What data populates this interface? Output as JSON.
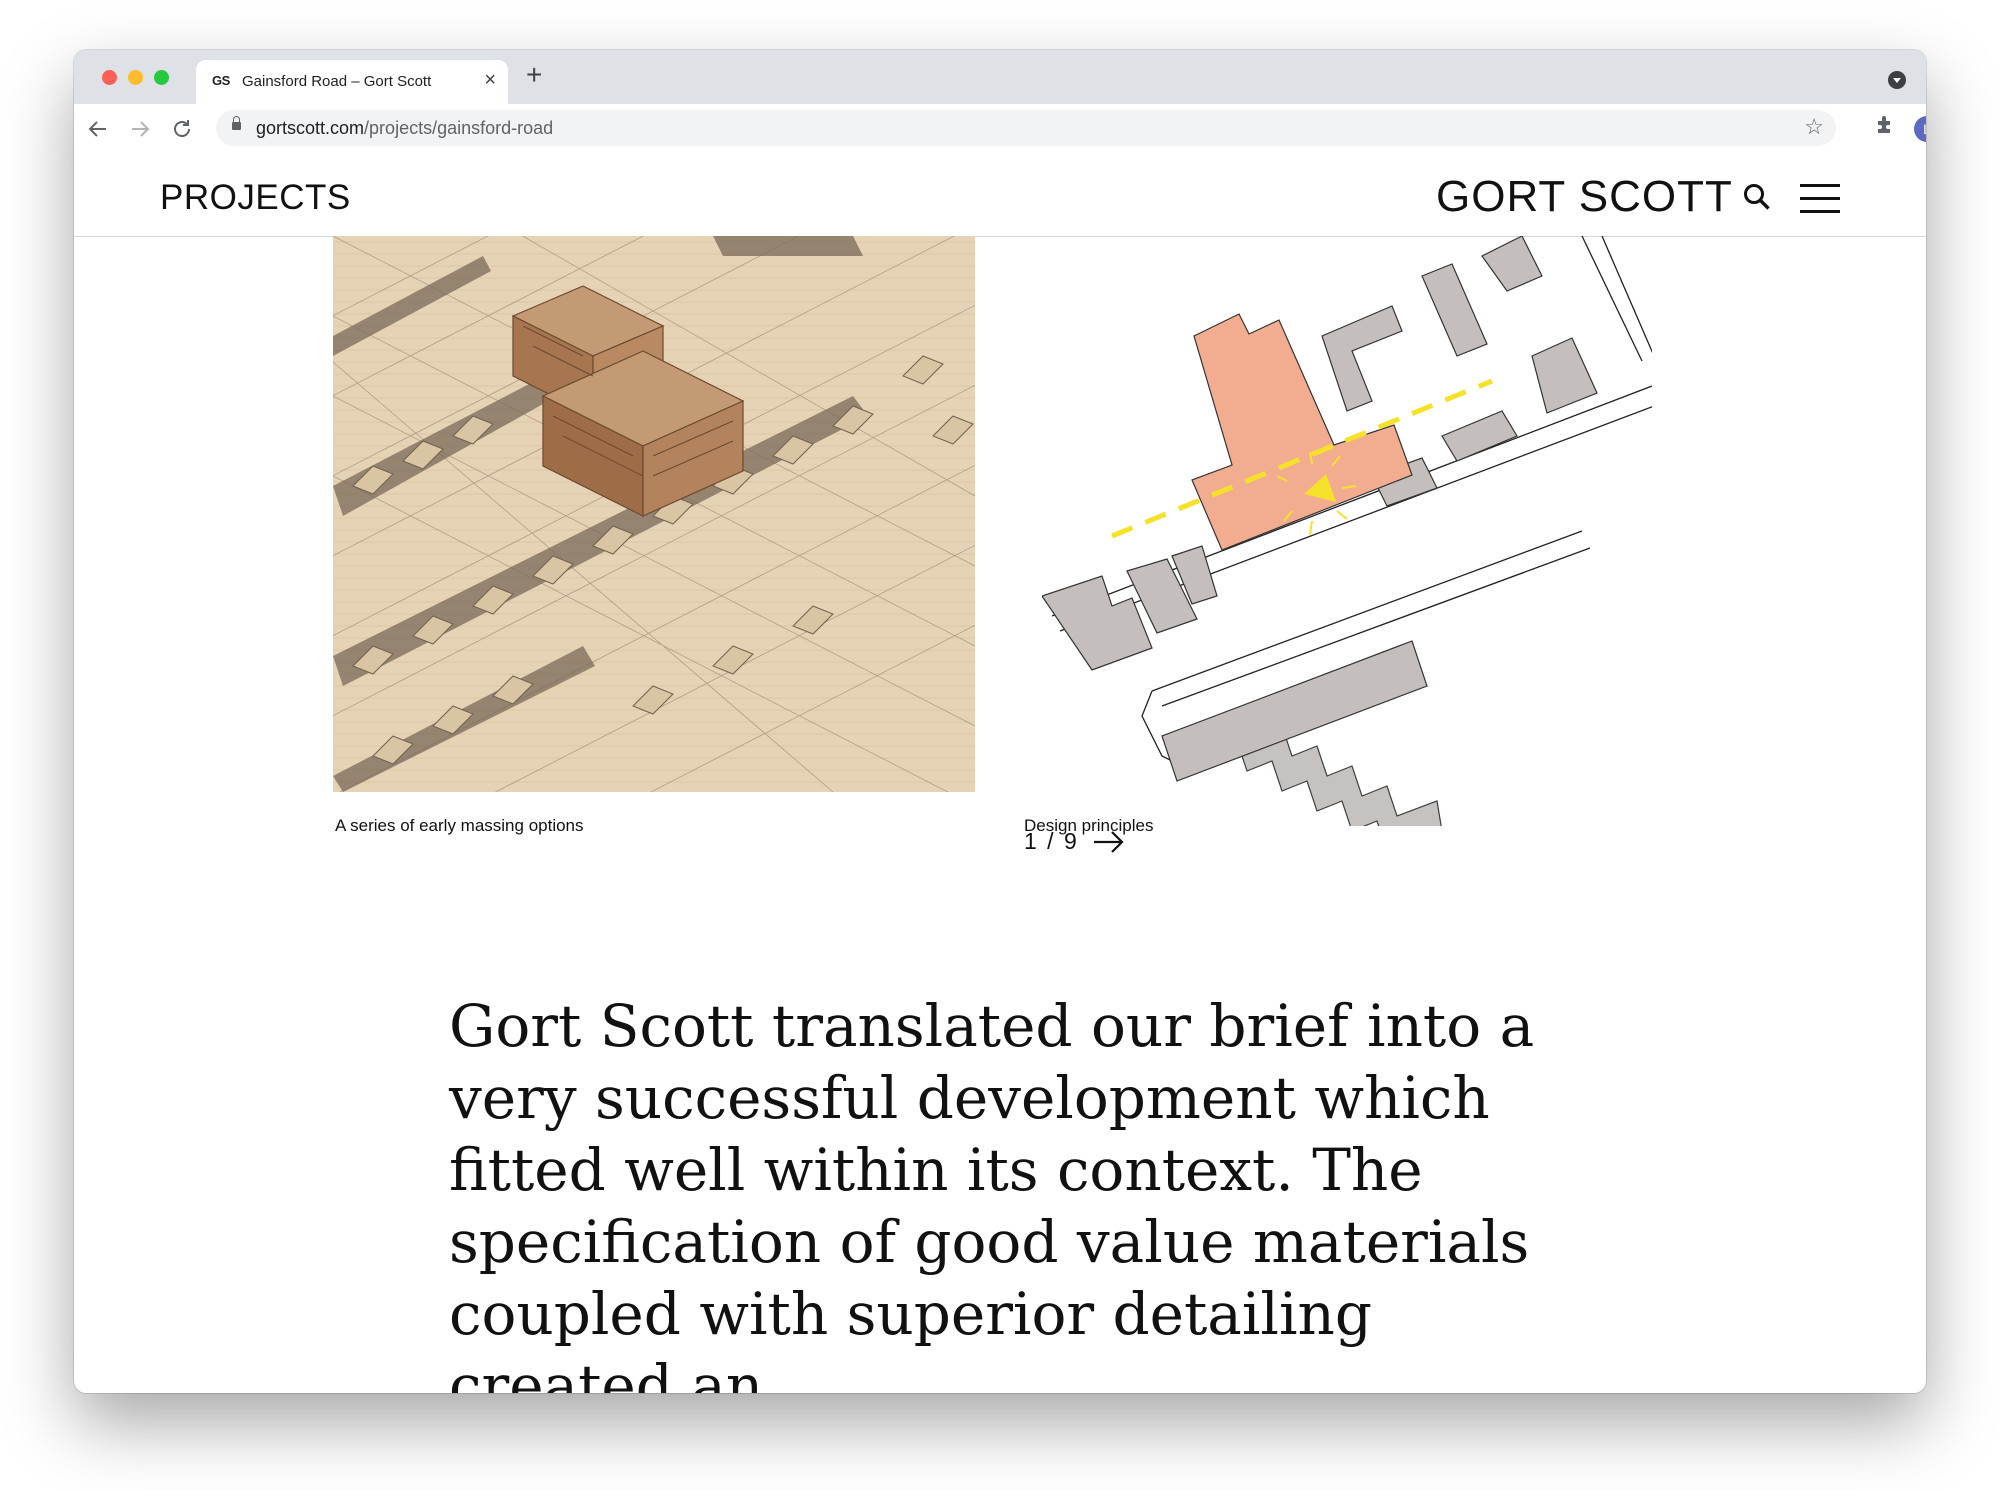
{
  "browser": {
    "tab": {
      "favicon_text": "GS",
      "title": "Gainsford Road – Gort Scott",
      "close_glyph": "×"
    },
    "new_tab_glyph": "+",
    "url_host": "gortscott.com",
    "url_path": "/projects/gainsford-road",
    "profile_initial": "L"
  },
  "site": {
    "section_title": "PROJECTS",
    "logo_text": "GORT SCOTT"
  },
  "gallery": {
    "left_caption": "A series of early massing options",
    "right_caption": "Design principles",
    "counter": "1 / 9"
  },
  "quote": {
    "text": "Gort Scott translated our brief into a very successful development which fitted well within its context. The specification of good value materials coupled with superior detailing created an"
  },
  "colors": {
    "massing_wood": "#e6d2b5",
    "highlight_block": "#f2ad90",
    "neighbour_grey": "#c4bfbc",
    "yellow_line": "#f5e12a"
  }
}
